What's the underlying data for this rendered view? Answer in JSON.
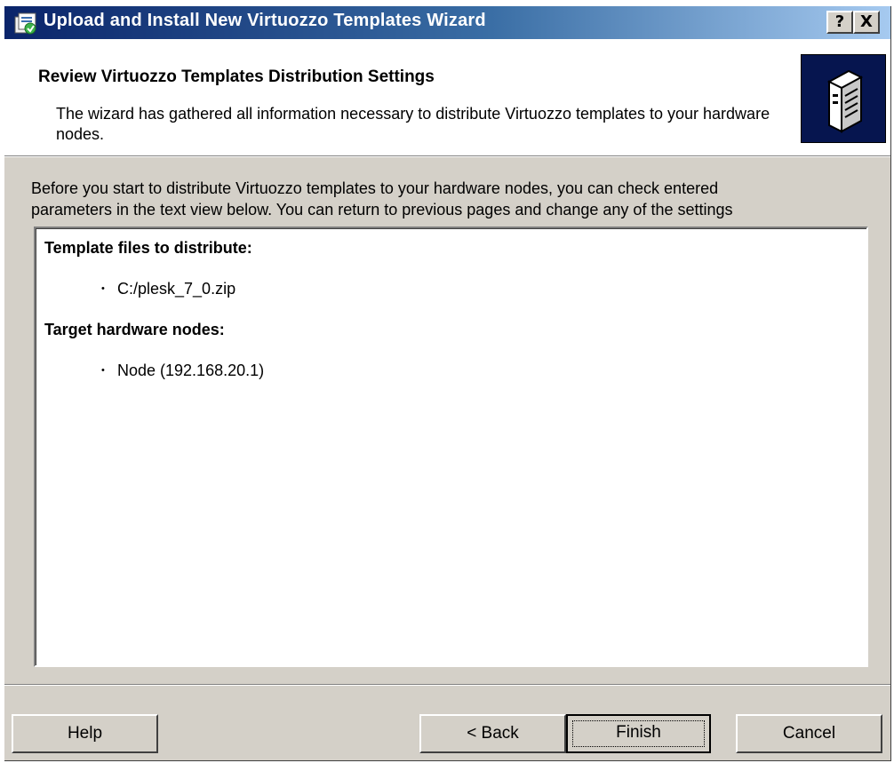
{
  "window": {
    "title": "Upload and Install New Virtuozzo Templates Wizard",
    "help_glyph": "?",
    "close_glyph": "X"
  },
  "header": {
    "title": "Review Virtuozzo Templates Distribution Settings",
    "description": "The wizard has gathered all information necessary to distribute Virtuozzo templates to your hardware nodes.",
    "icon": "server-icon"
  },
  "main": {
    "intro_line1": "Before you start to distribute Virtuozzo templates to your hardware nodes, you can check entered",
    "intro_line2": "parameters in the text view below. You can return to previous pages and change any of the settings"
  },
  "summary": {
    "sections": [
      {
        "heading": "Template files to distribute:",
        "items": [
          "C:/plesk_7_0.zip"
        ]
      },
      {
        "heading": "Target hardware nodes:",
        "items": [
          "Node (192.168.20.1)"
        ]
      }
    ],
    "bullet_glyph": "•"
  },
  "buttons": {
    "help": "Help",
    "back": "< Back",
    "finish": "Finish",
    "cancel": "Cancel"
  },
  "colors": {
    "titlebar_start": "#0a246a",
    "titlebar_end": "#a6caf0",
    "dialog_face": "#d4d0c8",
    "header_icon_bg": "#06154f"
  }
}
